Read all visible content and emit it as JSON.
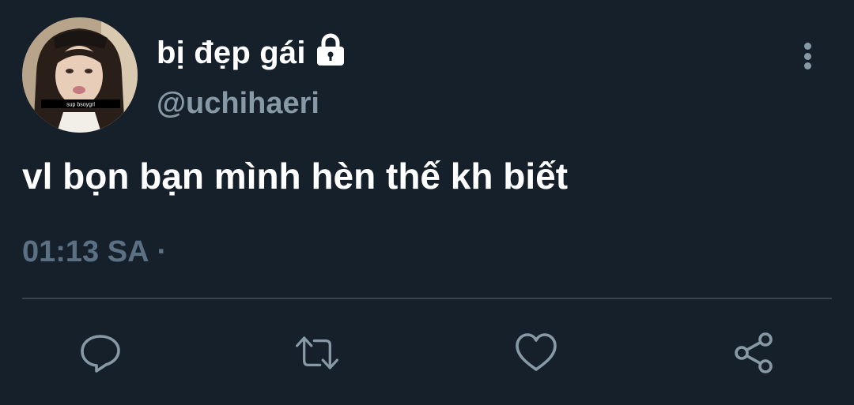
{
  "tweet": {
    "display_name": "bị đẹp gái",
    "handle": "@uchihaeri",
    "avatar_caption": "sup bsoygrl",
    "text": "vl bọn bạn mình hèn thế kh biết",
    "time": "01:13 SA",
    "separator": "·"
  },
  "icons": {
    "lock": "lock-icon",
    "more": "more-vertical-icon",
    "reply": "reply-icon",
    "retweet": "retweet-icon",
    "like": "heart-icon",
    "share": "share-icon"
  },
  "colors": {
    "background": "#15202b",
    "primary_text": "#ffffff",
    "secondary_text": "#8899a6",
    "meta_text": "#5b7083",
    "divider": "#38444d"
  }
}
